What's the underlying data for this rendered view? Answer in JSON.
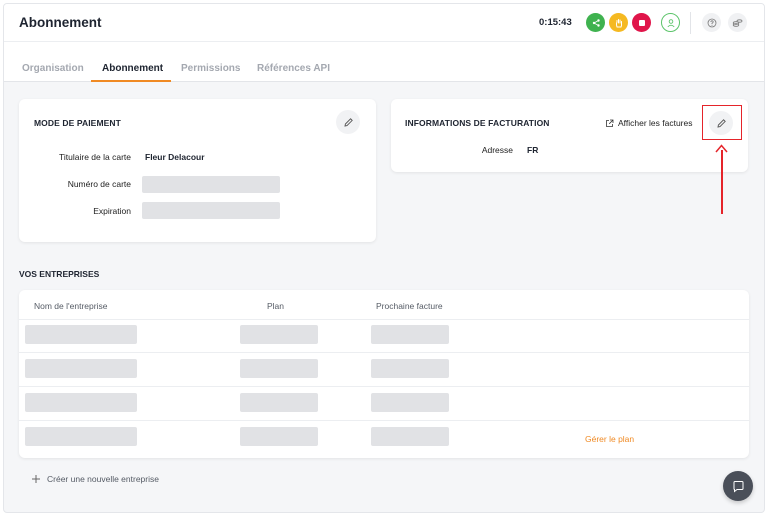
{
  "header": {
    "title": "Abonnement",
    "timer": "0:15:43"
  },
  "tabs": [
    {
      "label": "Organisation"
    },
    {
      "label": "Abonnement"
    },
    {
      "label": "Permissions"
    },
    {
      "label": "Références API"
    }
  ],
  "payment": {
    "title": "MODE DE PAIEMENT",
    "holder_label": "Titulaire de la carte",
    "holder_value": "Fleur Delacour",
    "card_label": "Numéro de carte",
    "expiry_label": "Expiration"
  },
  "billing": {
    "title": "INFORMATIONS DE FACTURATION",
    "invoices_link": "Afficher les factures",
    "address_label": "Adresse",
    "address_value": "FR"
  },
  "companies": {
    "title": "VOS ENTREPRISES",
    "columns": [
      "Nom de l'entreprise",
      "Plan",
      "Prochaine facture"
    ],
    "manage_plan": "Gérer le plan",
    "create_new": "Créer une nouvelle entreprise"
  },
  "colors": {
    "accent": "#f08a24",
    "annotation": "#e5242a"
  }
}
